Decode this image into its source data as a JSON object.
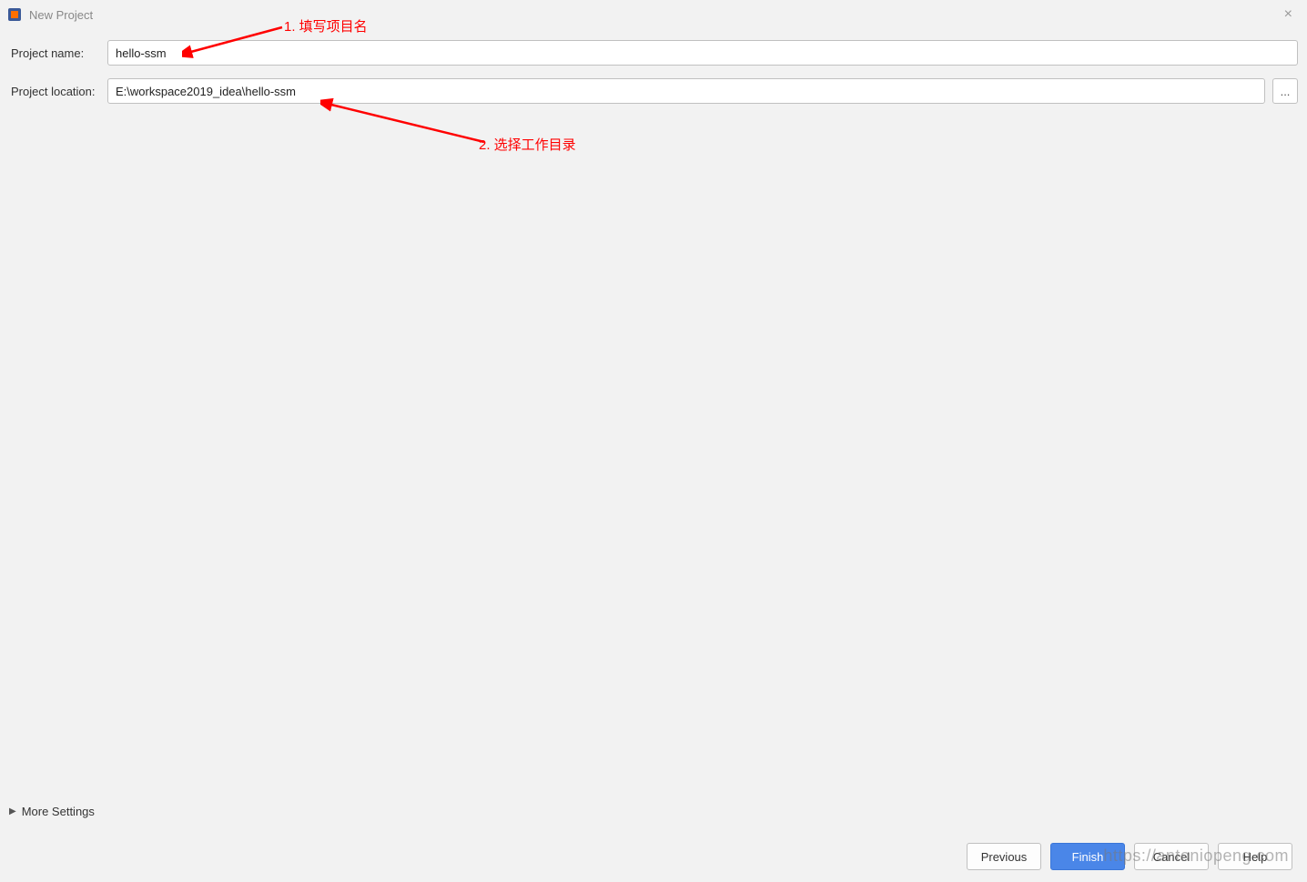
{
  "window": {
    "title": "New Project"
  },
  "form": {
    "project_name_label": "Project name:",
    "project_name_value": "hello-ssm",
    "project_location_label": "Project location:",
    "project_location_value": "E:\\workspace2019_idea\\hello-ssm",
    "browse_label": "..."
  },
  "more_settings_label": "More Settings",
  "buttons": {
    "previous": "Previous",
    "finish": "Finish",
    "cancel": "Cancel",
    "help": "Help"
  },
  "annotations": {
    "a1": "1. 填写项目名",
    "a2": "2. 选择工作目录"
  },
  "watermark": "https://antoniopeng.com"
}
